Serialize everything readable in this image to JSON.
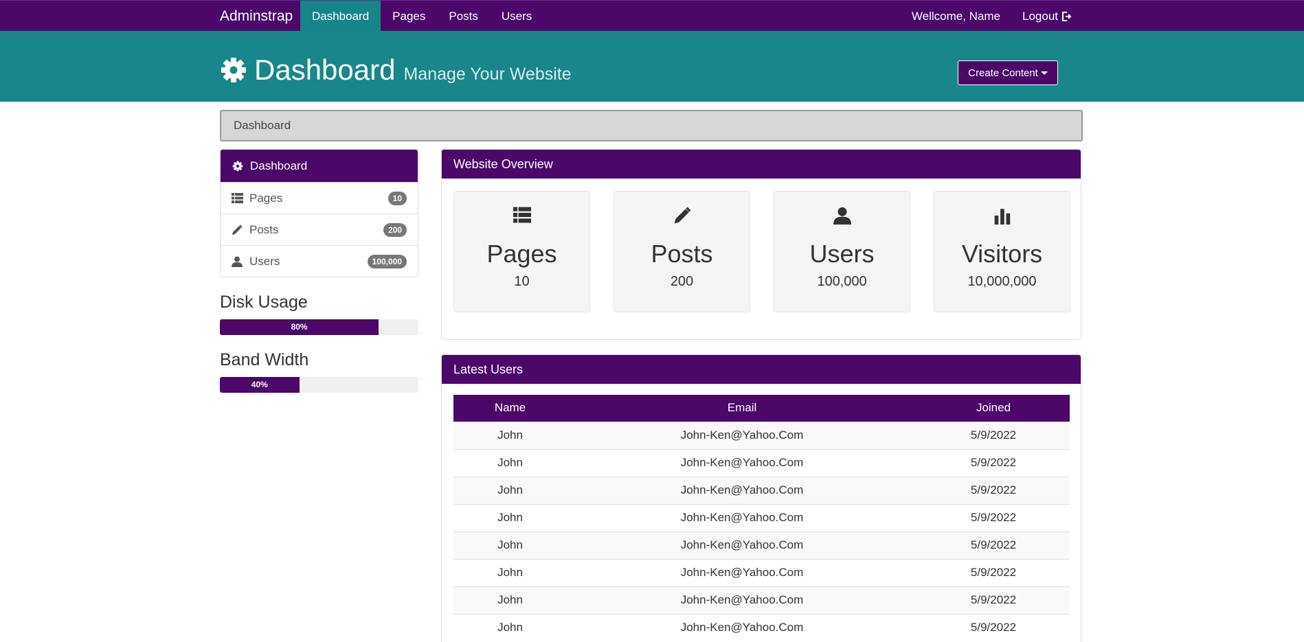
{
  "navbar": {
    "brand": "Adminstrap",
    "links": [
      "Dashboard",
      "Pages",
      "Posts",
      "Users"
    ],
    "welcome": "Wellcome, Name",
    "logout": "Logout"
  },
  "header": {
    "title": "Dashboard",
    "subtitle": "Manage Your Website",
    "create_button": "Create Content"
  },
  "breadcrumb": "Dashboard",
  "sidebar": {
    "items": [
      {
        "label": "Dashboard",
        "icon": "gear-icon"
      },
      {
        "label": "Pages",
        "icon": "list-icon",
        "badge": "10"
      },
      {
        "label": "Posts",
        "icon": "pencil-icon",
        "badge": "200"
      },
      {
        "label": "Users",
        "icon": "user-icon",
        "badge": "100,000"
      }
    ],
    "disk_usage": {
      "title": "Disk Usage",
      "percent_label": "80%",
      "value": 80
    },
    "bandwidth": {
      "title": "Band Width",
      "percent_label": "40%",
      "value": 40
    }
  },
  "overview": {
    "title": "Website Overview",
    "cards": [
      {
        "label": "Pages",
        "value": "10",
        "icon": "list-icon"
      },
      {
        "label": "Posts",
        "value": "200",
        "icon": "pencil-icon"
      },
      {
        "label": "Users",
        "value": "100,000",
        "icon": "user-icon"
      },
      {
        "label": "Visitors",
        "value": "10,000,000",
        "icon": "bar-chart-icon"
      }
    ]
  },
  "latest_users": {
    "title": "Latest Users",
    "columns": [
      "Name",
      "Email",
      "Joined"
    ],
    "rows": [
      [
        "John",
        "John-Ken@Yahoo.Com",
        "5/9/2022"
      ],
      [
        "John",
        "John-Ken@Yahoo.Com",
        "5/9/2022"
      ],
      [
        "John",
        "John-Ken@Yahoo.Com",
        "5/9/2022"
      ],
      [
        "John",
        "John-Ken@Yahoo.Com",
        "5/9/2022"
      ],
      [
        "John",
        "John-Ken@Yahoo.Com",
        "5/9/2022"
      ],
      [
        "John",
        "John-Ken@Yahoo.Com",
        "5/9/2022"
      ],
      [
        "John",
        "John-Ken@Yahoo.Com",
        "5/9/2022"
      ],
      [
        "John",
        "John-Ken@Yahoo.Com",
        "5/9/2022"
      ]
    ]
  },
  "colors": {
    "primary": "#4b0869",
    "header": "#18868a",
    "active_nav": "#17848a"
  }
}
